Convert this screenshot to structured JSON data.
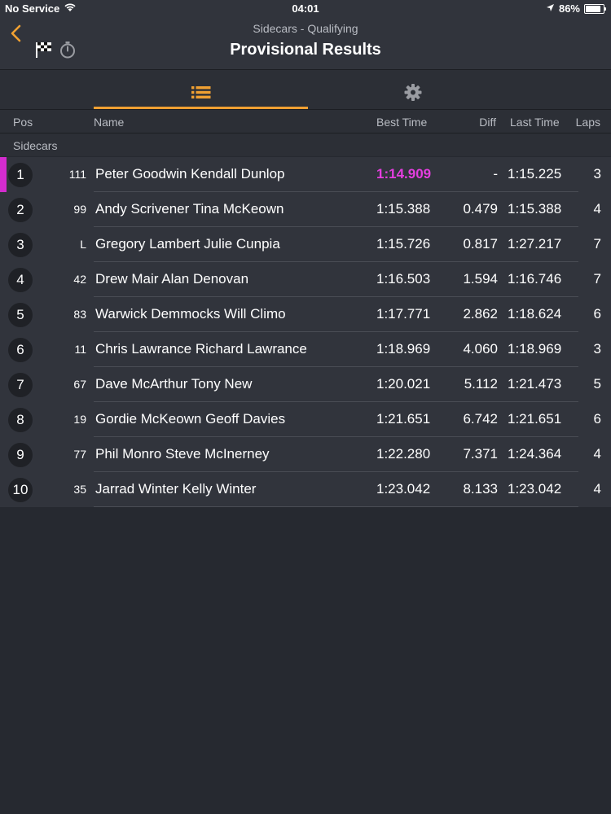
{
  "status_bar": {
    "carrier": "No Service",
    "time": "04:01",
    "battery": "86%",
    "battery_level": 0.86
  },
  "nav": {
    "subtitle": "Sidecars - Qualifying",
    "title": "Provisional Results"
  },
  "columns": {
    "pos": "Pos",
    "name": "Name",
    "best_time": "Best Time",
    "diff": "Diff",
    "last_time": "Last Time",
    "laps": "Laps"
  },
  "section": "Sidecars",
  "colors": {
    "accent": "#f0a032",
    "fastest": "#e53ee0"
  },
  "rows": [
    {
      "pos": "1",
      "number": "111",
      "name": "Peter Goodwin Kendall Dunlop",
      "best": "1:14.909",
      "diff": "-",
      "last": "1:15.225",
      "laps": "3",
      "fastest": true
    },
    {
      "pos": "2",
      "number": "99",
      "name": "Andy Scrivener Tina McKeown",
      "best": "1:15.388",
      "diff": "0.479",
      "last": "1:15.388",
      "laps": "4"
    },
    {
      "pos": "3",
      "number": "L",
      "name": "Gregory Lambert Julie Cunpia",
      "best": "1:15.726",
      "diff": "0.817",
      "last": "1:27.217",
      "laps": "7"
    },
    {
      "pos": "4",
      "number": "42",
      "name": "Drew Mair Alan Denovan",
      "best": "1:16.503",
      "diff": "1.594",
      "last": "1:16.746",
      "laps": "7"
    },
    {
      "pos": "5",
      "number": "83",
      "name": "Warwick Demmocks Will Climo",
      "best": "1:17.771",
      "diff": "2.862",
      "last": "1:18.624",
      "laps": "6"
    },
    {
      "pos": "6",
      "number": "11",
      "name": "Chris Lawrance Richard Lawrance",
      "best": "1:18.969",
      "diff": "4.060",
      "last": "1:18.969",
      "laps": "3"
    },
    {
      "pos": "7",
      "number": "67",
      "name": "Dave McArthur Tony New",
      "best": "1:20.021",
      "diff": "5.112",
      "last": "1:21.473",
      "laps": "5"
    },
    {
      "pos": "8",
      "number": "19",
      "name": "Gordie McKeown Geoff Davies",
      "best": "1:21.651",
      "diff": "6.742",
      "last": "1:21.651",
      "laps": "6"
    },
    {
      "pos": "9",
      "number": "77",
      "name": "Phil Monro Steve McInerney",
      "best": "1:22.280",
      "diff": "7.371",
      "last": "1:24.364",
      "laps": "4"
    },
    {
      "pos": "10",
      "number": "35",
      "name": "Jarrad Winter Kelly Winter",
      "best": "1:23.042",
      "diff": "8.133",
      "last": "1:23.042",
      "laps": "4"
    }
  ]
}
